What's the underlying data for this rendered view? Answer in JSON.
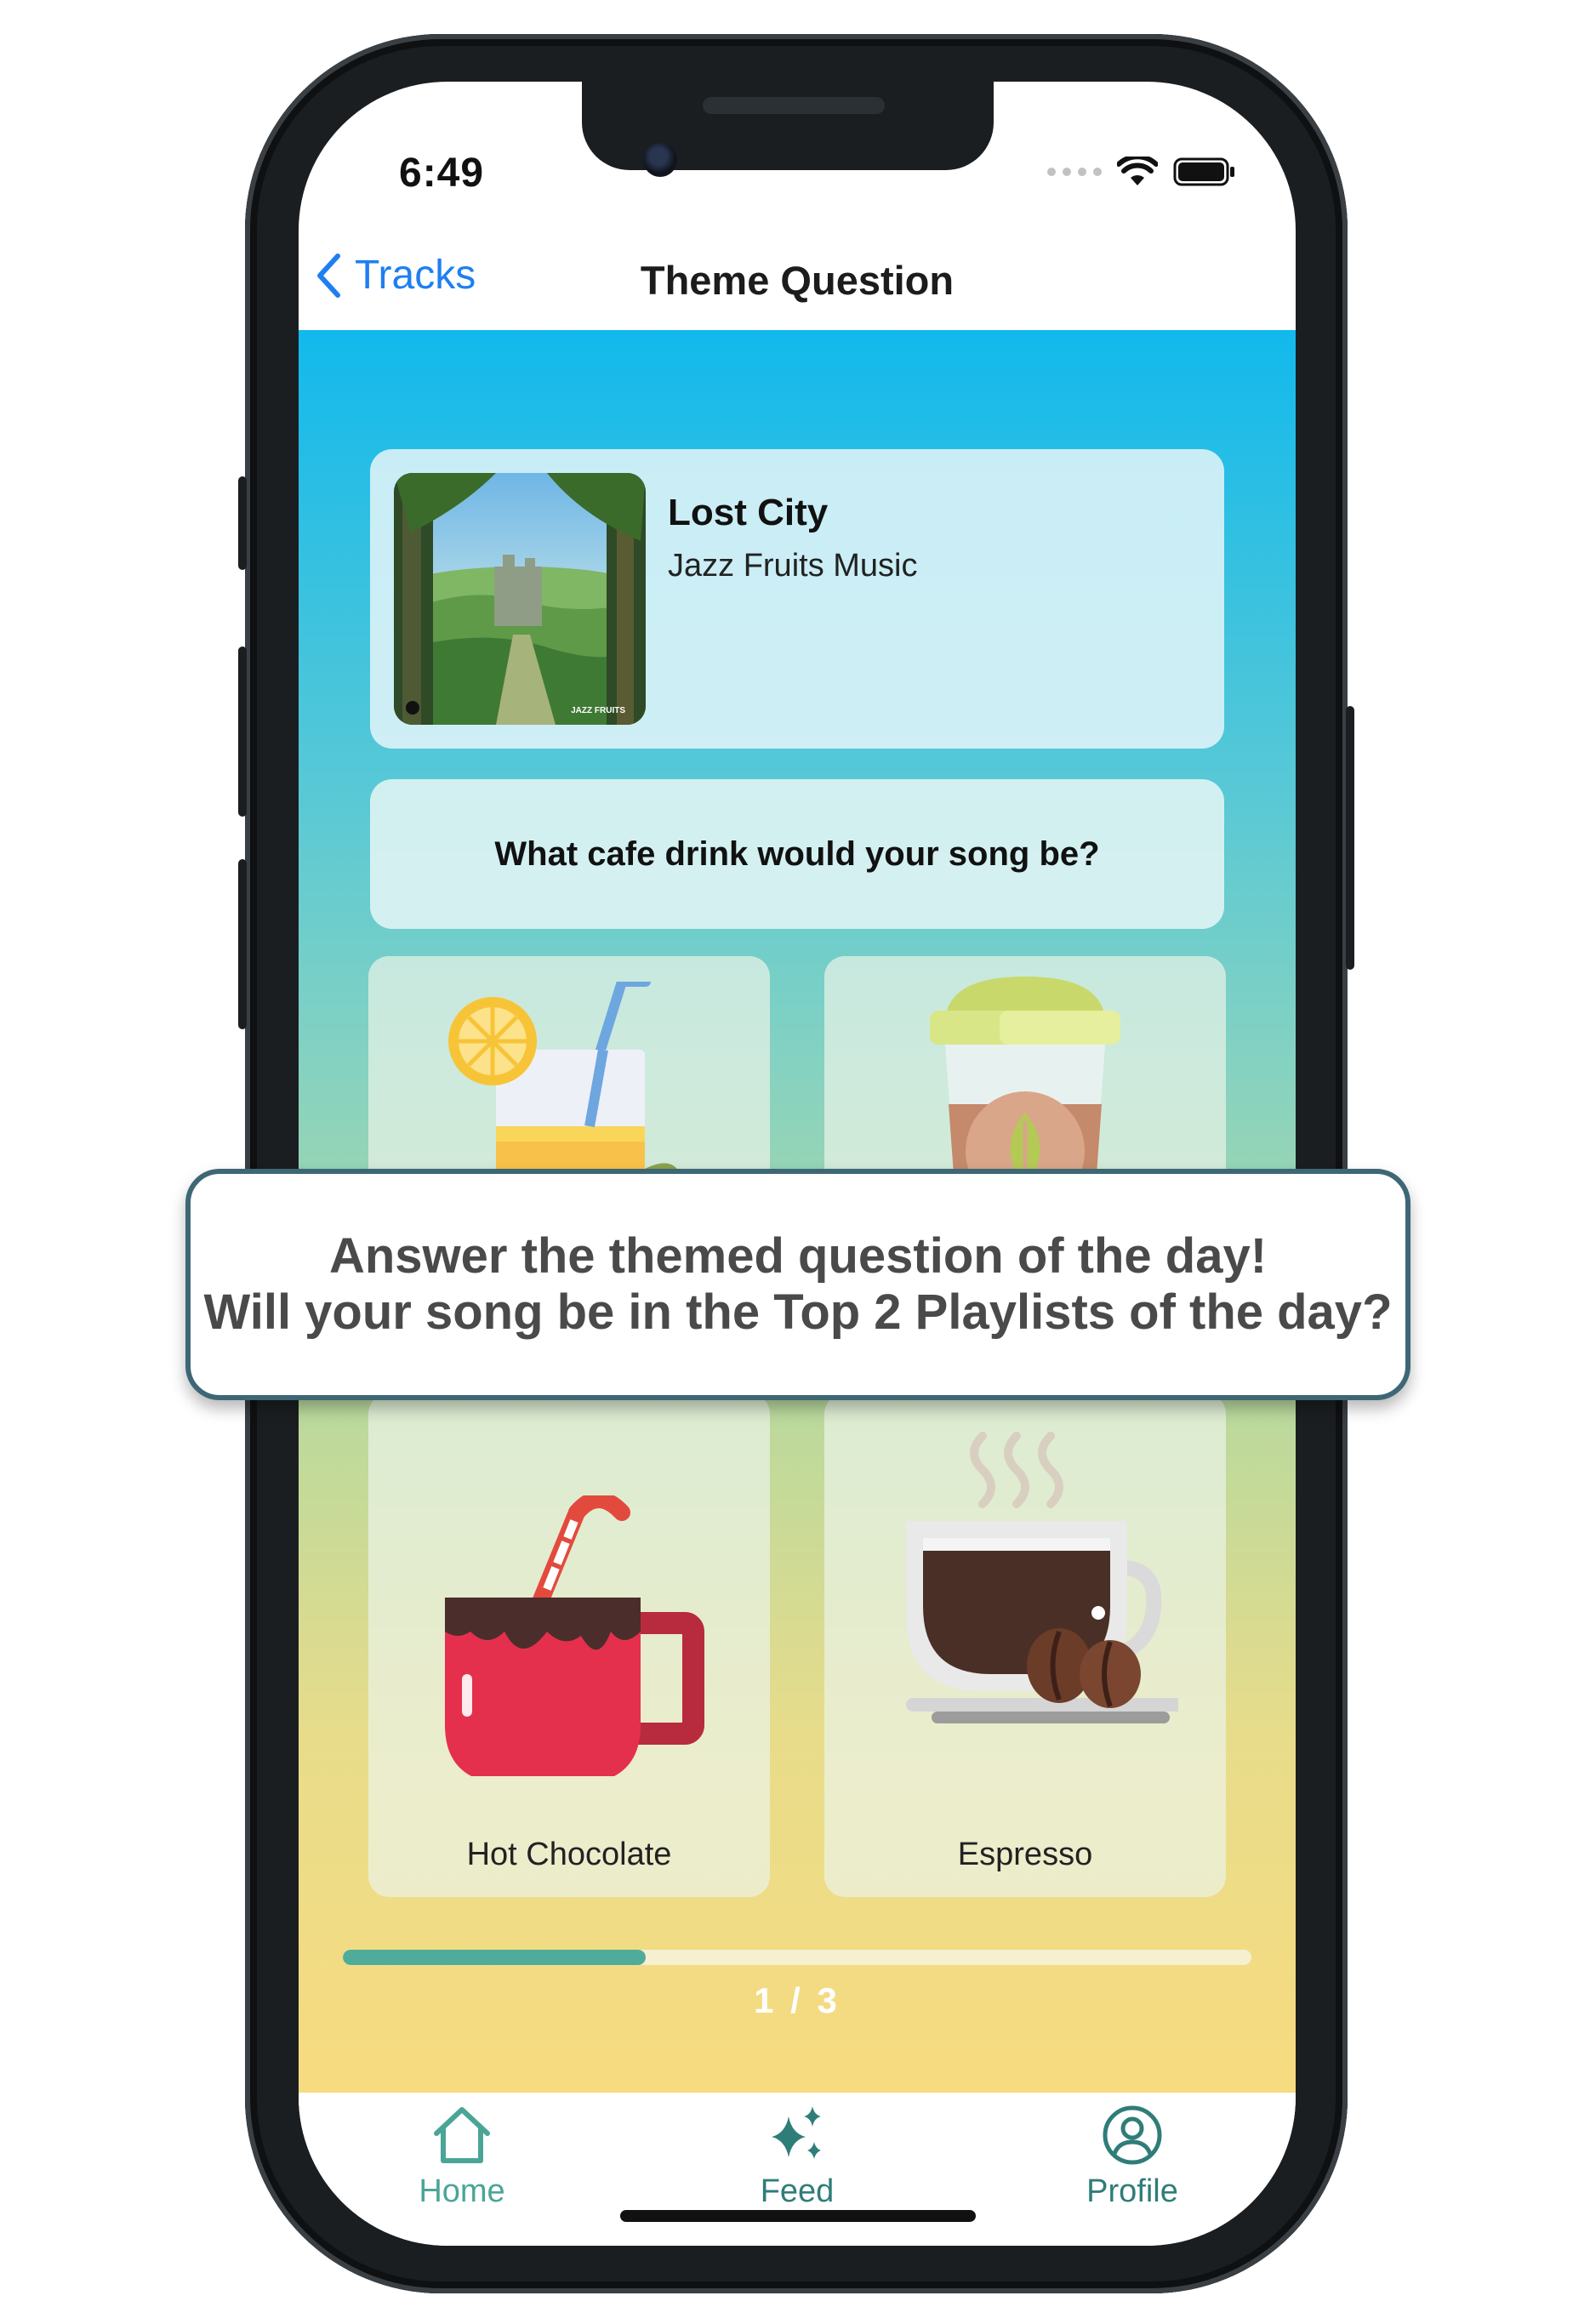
{
  "status_bar": {
    "time": "6:49"
  },
  "nav": {
    "back_label": "Tracks",
    "title": "Theme Question"
  },
  "track": {
    "title": "Lost City",
    "artist": "Jazz Fruits Music",
    "art_watermark": "JAZZ FRUITS"
  },
  "question": {
    "text": "What cafe drink would your song be?"
  },
  "options": [
    {
      "label": "",
      "icon": "lemonade-icon"
    },
    {
      "label": "",
      "icon": "matcha-cup-icon"
    },
    {
      "label": "Hot Chocolate",
      "icon": "hot-chocolate-icon"
    },
    {
      "label": "Espresso",
      "icon": "espresso-icon"
    }
  ],
  "progress": {
    "label": "1 / 3",
    "fraction": 0.333
  },
  "tabs": {
    "home": "Home",
    "feed": "Feed",
    "profile": "Profile"
  },
  "callout": {
    "line1": "Answer the themed question of the day!",
    "line2": "Will your song be in the Top 2 Playlists of the day?"
  },
  "colors": {
    "accent_blue": "#1f7ff0",
    "teal": "#4fac9a",
    "callout_border": "#3d6775"
  }
}
